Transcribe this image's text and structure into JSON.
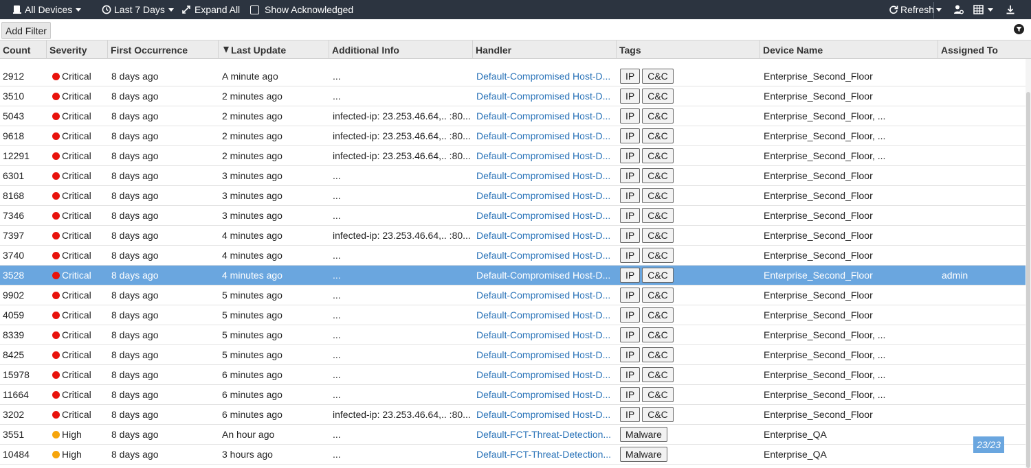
{
  "toolbar": {
    "devices": "All Devices",
    "range": "Last 7 Days",
    "expand": "Expand All",
    "show_ack": "Show Acknowledged",
    "refresh": "Refresh"
  },
  "filterbar": {
    "add_filter": "Add Filter"
  },
  "columns": {
    "count": "Count",
    "severity": "Severity",
    "first": "First Occurrence",
    "last": "Last Update",
    "info": "Additional Info",
    "handler": "Handler",
    "tags": "Tags",
    "device": "Device Name",
    "assigned": "Assigned To"
  },
  "colors": {
    "critical": "#e8120c",
    "high": "#f6a50b",
    "selected": "#6aa6df",
    "toolbar": "#2c3440",
    "link": "#2a73b8"
  },
  "rows": [
    {
      "count": "2912",
      "severity": "Critical",
      "first": "8 days ago",
      "last": "A minute ago",
      "info": "...",
      "handler": "Default-Compromised Host-D...",
      "tags": [
        "IP",
        "C&C"
      ],
      "device": "Enterprise_Second_Floor",
      "assigned": ""
    },
    {
      "count": "3510",
      "severity": "Critical",
      "first": "8 days ago",
      "last": "2 minutes ago",
      "info": "...",
      "handler": "Default-Compromised Host-D...",
      "tags": [
        "IP",
        "C&C"
      ],
      "device": "Enterprise_Second_Floor",
      "assigned": ""
    },
    {
      "count": "5043",
      "severity": "Critical",
      "first": "8 days ago",
      "last": "2 minutes ago",
      "info": "infected-ip: 23.253.46.64,.. :80...",
      "handler": "Default-Compromised Host-D...",
      "tags": [
        "IP",
        "C&C"
      ],
      "device": "Enterprise_Second_Floor, ...",
      "assigned": ""
    },
    {
      "count": "9618",
      "severity": "Critical",
      "first": "8 days ago",
      "last": "2 minutes ago",
      "info": "infected-ip: 23.253.46.64,.. :80...",
      "handler": "Default-Compromised Host-D...",
      "tags": [
        "IP",
        "C&C"
      ],
      "device": "Enterprise_Second_Floor, ...",
      "assigned": ""
    },
    {
      "count": "12291",
      "severity": "Critical",
      "first": "8 days ago",
      "last": "2 minutes ago",
      "info": "infected-ip: 23.253.46.64,.. :80...",
      "handler": "Default-Compromised Host-D...",
      "tags": [
        "IP",
        "C&C"
      ],
      "device": "Enterprise_Second_Floor, ...",
      "assigned": ""
    },
    {
      "count": "6301",
      "severity": "Critical",
      "first": "8 days ago",
      "last": "3 minutes ago",
      "info": "...",
      "handler": "Default-Compromised Host-D...",
      "tags": [
        "IP",
        "C&C"
      ],
      "device": "Enterprise_Second_Floor",
      "assigned": ""
    },
    {
      "count": "8168",
      "severity": "Critical",
      "first": "8 days ago",
      "last": "3 minutes ago",
      "info": "...",
      "handler": "Default-Compromised Host-D...",
      "tags": [
        "IP",
        "C&C"
      ],
      "device": "Enterprise_Second_Floor",
      "assigned": ""
    },
    {
      "count": "7346",
      "severity": "Critical",
      "first": "8 days ago",
      "last": "3 minutes ago",
      "info": "...",
      "handler": "Default-Compromised Host-D...",
      "tags": [
        "IP",
        "C&C"
      ],
      "device": "Enterprise_Second_Floor",
      "assigned": ""
    },
    {
      "count": "7397",
      "severity": "Critical",
      "first": "8 days ago",
      "last": "4 minutes ago",
      "info": "infected-ip: 23.253.46.64,.. :80...",
      "handler": "Default-Compromised Host-D...",
      "tags": [
        "IP",
        "C&C"
      ],
      "device": "Enterprise_Second_Floor",
      "assigned": ""
    },
    {
      "count": "3740",
      "severity": "Critical",
      "first": "8 days ago",
      "last": "4 minutes ago",
      "info": "...",
      "handler": "Default-Compromised Host-D...",
      "tags": [
        "IP",
        "C&C"
      ],
      "device": "Enterprise_Second_Floor",
      "assigned": ""
    },
    {
      "count": "3528",
      "severity": "Critical",
      "first": "8 days ago",
      "last": "4 minutes ago",
      "info": "...",
      "handler": "Default-Compromised Host-D...",
      "tags": [
        "IP",
        "C&C"
      ],
      "device": "Enterprise_Second_Floor",
      "assigned": "admin",
      "selected": true
    },
    {
      "count": "9902",
      "severity": "Critical",
      "first": "8 days ago",
      "last": "5 minutes ago",
      "info": "...",
      "handler": "Default-Compromised Host-D...",
      "tags": [
        "IP",
        "C&C"
      ],
      "device": "Enterprise_Second_Floor",
      "assigned": ""
    },
    {
      "count": "4059",
      "severity": "Critical",
      "first": "8 days ago",
      "last": "5 minutes ago",
      "info": "...",
      "handler": "Default-Compromised Host-D...",
      "tags": [
        "IP",
        "C&C"
      ],
      "device": "Enterprise_Second_Floor",
      "assigned": ""
    },
    {
      "count": "8339",
      "severity": "Critical",
      "first": "8 days ago",
      "last": "5 minutes ago",
      "info": "...",
      "handler": "Default-Compromised Host-D...",
      "tags": [
        "IP",
        "C&C"
      ],
      "device": "Enterprise_Second_Floor, ...",
      "assigned": ""
    },
    {
      "count": "8425",
      "severity": "Critical",
      "first": "8 days ago",
      "last": "5 minutes ago",
      "info": "...",
      "handler": "Default-Compromised Host-D...",
      "tags": [
        "IP",
        "C&C"
      ],
      "device": "Enterprise_Second_Floor, ...",
      "assigned": ""
    },
    {
      "count": "15978",
      "severity": "Critical",
      "first": "8 days ago",
      "last": "6 minutes ago",
      "info": "...",
      "handler": "Default-Compromised Host-D...",
      "tags": [
        "IP",
        "C&C"
      ],
      "device": "Enterprise_Second_Floor, ...",
      "assigned": ""
    },
    {
      "count": "11664",
      "severity": "Critical",
      "first": "8 days ago",
      "last": "6 minutes ago",
      "info": "...",
      "handler": "Default-Compromised Host-D...",
      "tags": [
        "IP",
        "C&C"
      ],
      "device": "Enterprise_Second_Floor, ...",
      "assigned": ""
    },
    {
      "count": "3202",
      "severity": "Critical",
      "first": "8 days ago",
      "last": "6 minutes ago",
      "info": "infected-ip: 23.253.46.64,.. :80...",
      "handler": "Default-Compromised Host-D...",
      "tags": [
        "IP",
        "C&C"
      ],
      "device": "Enterprise_Second_Floor",
      "assigned": ""
    },
    {
      "count": "3551",
      "severity": "High",
      "first": "8 days ago",
      "last": "An hour ago",
      "info": "...",
      "handler": "Default-FCT-Threat-Detection...",
      "tags": [
        "Malware"
      ],
      "device": "Enterprise_QA",
      "assigned": ""
    },
    {
      "count": "10484",
      "severity": "High",
      "first": "8 days ago",
      "last": "3 hours ago",
      "info": "...",
      "handler": "Default-FCT-Threat-Detection...",
      "tags": [
        "Malware"
      ],
      "device": "Enterprise_QA",
      "assigned": ""
    }
  ],
  "pager": "23/23"
}
